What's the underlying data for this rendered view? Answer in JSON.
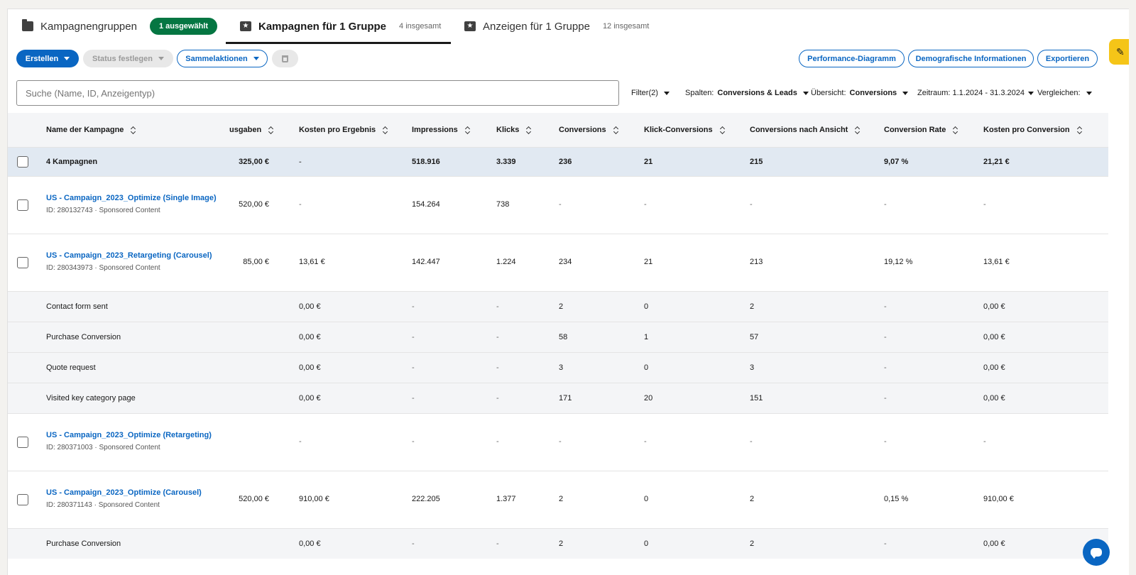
{
  "tabs": [
    {
      "label": "Kampagnengruppen",
      "badge": "1 ausgewählt",
      "icon": "folder-icon"
    },
    {
      "label": "Kampagnen für 1 Gruppe",
      "count": "4 insgesamt",
      "icon": "star-icon"
    },
    {
      "label": "Anzeigen für 1 Gruppe",
      "count": "12 insgesamt",
      "icon": "star-icon"
    }
  ],
  "toolbar": {
    "create": "Erstellen",
    "set_status": "Status festlegen",
    "bulk_actions": "Sammelaktionen",
    "performance_chart": "Performance-Diagramm",
    "demographics": "Demografische Informationen",
    "export": "Exportieren"
  },
  "search": {
    "placeholder": "Suche (Name, ID, Anzeigentyp)"
  },
  "filters": {
    "filter": "Filter(2)",
    "columns_label": "Spalten:",
    "columns_value": "Conversions & Leads",
    "overview_label": "Übersicht:",
    "overview_value": "Conversions",
    "range_label": "Zeitraum:",
    "range_value": "1.1.2024 - 31.3.2024",
    "compare_label": "Vergleichen:"
  },
  "columns": {
    "name": "Name der Kampagne",
    "spend": "usgaben",
    "cost_per_result": "Kosten pro Ergebnis",
    "impressions": "Impressions",
    "clicks": "Klicks",
    "conversions": "Conversions",
    "click_conversions": "Klick-Conversions",
    "view_conversions": "Conversions nach Ansicht",
    "conversion_rate": "Conversion Rate",
    "cost_per_conversion": "Kosten pro Conversion"
  },
  "rows": [
    {
      "name": "4 Kampagnen",
      "spend": "325,00 €",
      "cpr": "-",
      "impr": "518.916",
      "clicks": "3.339",
      "conv": "236",
      "click_conv": "21",
      "view_conv": "215",
      "rate": "9,07 %",
      "cpc": "21,21 €"
    },
    {
      "name": "US - Campaign_2023_Optimize (Single Image)",
      "sub": "ID: 280132743 · Sponsored Content",
      "spend": "520,00 €",
      "cpr": "-",
      "impr": "154.264",
      "clicks": "738",
      "conv": "-",
      "click_conv": "-",
      "view_conv": "-",
      "rate": "-",
      "cpc": "-"
    },
    {
      "name": "US - Campaign_2023_Retargeting (Carousel)",
      "sub": "ID: 280343973 · Sponsored Content",
      "spend": "85,00 €",
      "cpr": "13,61 €",
      "impr": "142.447",
      "clicks": "1.224",
      "conv": "234",
      "click_conv": "21",
      "view_conv": "213",
      "rate": "19,12 %",
      "cpc": "13,61 €"
    },
    {
      "name": "Contact form sent",
      "cpr": "0,00 €",
      "impr": "-",
      "clicks": "-",
      "conv": "2",
      "click_conv": "0",
      "view_conv": "2",
      "rate": "-",
      "cpc": "0,00 €"
    },
    {
      "name": "Purchase Conversion",
      "cpr": "0,00 €",
      "impr": "-",
      "clicks": "-",
      "conv": "58",
      "click_conv": "1",
      "view_conv": "57",
      "rate": "-",
      "cpc": "0,00 €"
    },
    {
      "name": "Quote request",
      "cpr": "0,00 €",
      "impr": "-",
      "clicks": "-",
      "conv": "3",
      "click_conv": "0",
      "view_conv": "3",
      "rate": "-",
      "cpc": "0,00 €"
    },
    {
      "name": "Visited key category page",
      "cpr": "0,00 €",
      "impr": "-",
      "clicks": "-",
      "conv": "171",
      "click_conv": "20",
      "view_conv": "151",
      "rate": "-",
      "cpc": "0,00 €"
    },
    {
      "name": "US - Campaign_2023_Optimize (Retargeting)",
      "sub": "ID: 280371003 · Sponsored Content",
      "spend": "-",
      "cpr": "-",
      "impr": "-",
      "clicks": "-",
      "conv": "-",
      "click_conv": "-",
      "view_conv": "-",
      "rate": "-",
      "cpc": "-"
    },
    {
      "name": "US - Campaign_2023_Optimize (Carousel)",
      "sub": "ID: 280371143 · Sponsored Content",
      "spend": "520,00 €",
      "cpr": "910,00 €",
      "impr": "222.205",
      "clicks": "1.377",
      "conv": "2",
      "click_conv": "0",
      "view_conv": "2",
      "rate": "0,15 %",
      "cpc": "910,00 €"
    },
    {
      "name": "Purchase Conversion",
      "cpr": "0,00 €",
      "impr": "-",
      "clicks": "-",
      "conv": "2",
      "click_conv": "0",
      "view_conv": "2",
      "rate": "-",
      "cpc": "0,00 €"
    }
  ],
  "colors": {
    "accent": "#0a66c2",
    "badge_green": "#057642",
    "total_row": "#e1e9f2",
    "helper_tab": "#f5c518"
  }
}
